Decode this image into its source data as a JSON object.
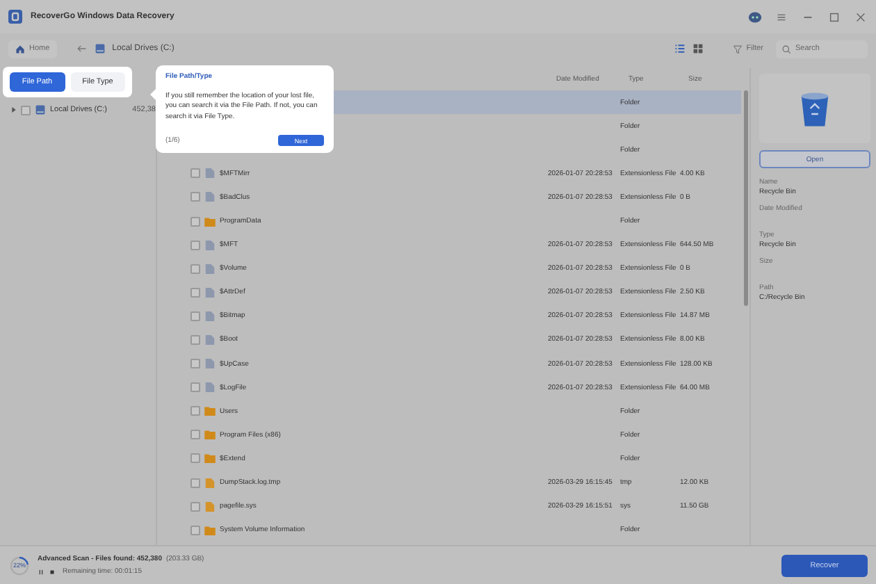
{
  "window": {
    "title": "RecoverGo Windows Data Recovery"
  },
  "toolbar": {
    "home": "Home",
    "path": "Local Drives (C:)",
    "views": [
      {
        "kind": "list",
        "selected": true
      },
      {
        "kind": "grid",
        "selected": false
      }
    ],
    "filter": "Filter",
    "search": {
      "placeholder": "Search"
    }
  },
  "tabs": [
    {
      "label": "File Path",
      "selected": true
    },
    {
      "label": "File Type",
      "selected": false
    }
  ],
  "tree": [
    {
      "label": "Local Drives (C:)",
      "count": "452,38",
      "expanded": false,
      "checked": false
    }
  ],
  "popup": {
    "title": "File Path/Type",
    "body": "If you still remember the location of your lost file, you can search it via the File Path. If not, you can search it via File Type.",
    "step": "(1/6)",
    "next": "Next"
  },
  "table": {
    "columns": [
      "Date Modified",
      "Type",
      "Size"
    ],
    "rows": [
      {
        "kind": "hidden",
        "type": "Folder",
        "selected": true
      },
      {
        "kind": "hidden",
        "type": "Folder",
        "selected": false
      },
      {
        "kind": "hidden",
        "type": "Folder",
        "selected": false
      },
      {
        "kind": "system",
        "name": "$MFTMirr",
        "date": "2026-01-07 20:28:53",
        "type": "Extensionless File",
        "size": "4.00 KB",
        "selected": false,
        "checked": false
      },
      {
        "kind": "system",
        "name": "$BadClus",
        "date": "2026-01-07 20:28:53",
        "type": "Extensionless File",
        "size": "0 B",
        "selected": false,
        "checked": false
      },
      {
        "kind": "folder",
        "name": "ProgramData",
        "type": "Folder",
        "selected": false,
        "checked": false
      },
      {
        "kind": "system",
        "name": "$MFT",
        "date": "2026-01-07 20:28:53",
        "type": "Extensionless File",
        "size": "644.50 MB",
        "selected": false,
        "checked": false
      },
      {
        "kind": "system",
        "name": "$Volume",
        "date": "2026-01-07 20:28:53",
        "type": "Extensionless File",
        "size": "0 B",
        "selected": false,
        "checked": false
      },
      {
        "kind": "system",
        "name": "$AttrDef",
        "date": "2026-01-07 20:28:53",
        "type": "Extensionless File",
        "size": "2.50 KB",
        "selected": false,
        "checked": false
      },
      {
        "kind": "system",
        "name": "$Bitmap",
        "date": "2026-01-07 20:28:53",
        "type": "Extensionless File",
        "size": "14.87 MB",
        "selected": false,
        "checked": false
      },
      {
        "kind": "system",
        "name": "$Boot",
        "date": "2026-01-07 20:28:53",
        "type": "Extensionless File",
        "size": "8.00 KB",
        "selected": false,
        "checked": false
      },
      {
        "kind": "system",
        "name": "$UpCase",
        "date": "2026-01-07 20:28:53",
        "type": "Extensionless File",
        "size": "128.00 KB",
        "selected": false,
        "checked": false
      },
      {
        "kind": "system",
        "name": "$LogFile",
        "date": "2026-01-07 20:28:53",
        "type": "Extensionless File",
        "size": "64.00 MB",
        "selected": false,
        "checked": false
      },
      {
        "kind": "folder",
        "name": "Users",
        "type": "Folder",
        "selected": false,
        "checked": false
      },
      {
        "kind": "folder",
        "name": "Program Files (x86)",
        "type": "Folder",
        "selected": false,
        "checked": false
      },
      {
        "kind": "folder",
        "name": "$Extend",
        "type": "Folder",
        "selected": false,
        "checked": false
      },
      {
        "kind": "file",
        "name": "DumpStack.log.tmp",
        "date": "2026-03-29 16:15:45",
        "type": "tmp",
        "size": "12.00 KB",
        "selected": false,
        "checked": false
      },
      {
        "kind": "file",
        "name": "pagefile.sys",
        "date": "2026-03-29 16:15:51",
        "type": "sys",
        "size": "11.50 GB",
        "selected": false,
        "checked": false
      },
      {
        "kind": "folder",
        "name": "System Volume Information",
        "type": "Folder",
        "selected": false,
        "checked": false
      }
    ]
  },
  "details": {
    "open": "Open",
    "fields": [
      {
        "label": "Name",
        "value": "Recycle Bin"
      },
      {
        "label": "Date Modified"
      },
      {
        "label": "Type",
        "value": "Recycle Bin"
      },
      {
        "label": "Size"
      },
      {
        "label": "Path",
        "value": "C:/Recycle Bin"
      }
    ]
  },
  "status": {
    "percent": "22%",
    "level": 0.22,
    "scan": "Advanced Scan - Files found: 452,380",
    "size": "(203.33 GB)",
    "remaining": "Remaining time: 00:01:15",
    "recover": "Recover"
  }
}
